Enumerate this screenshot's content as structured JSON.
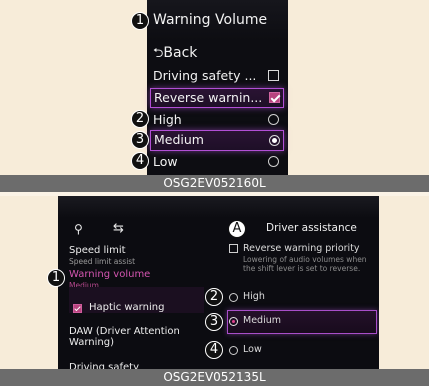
{
  "panel1": {
    "title": "Warning Volume",
    "back_label": "Back",
    "back_icon": "back-arrow-icon",
    "items": [
      {
        "label": "Driving safety ...",
        "checked": false
      },
      {
        "label": "Reverse warnin...",
        "checked": true
      }
    ],
    "options": [
      {
        "label": "High",
        "selected": false
      },
      {
        "label": "Medium",
        "selected": true
      },
      {
        "label": "Low",
        "selected": false
      }
    ],
    "callouts": [
      "1",
      "2",
      "3",
      "4"
    ],
    "caption": "OSG2EV052160L"
  },
  "panel2": {
    "toolbar_icons": [
      "search-icon",
      "swap-icon"
    ],
    "left_items": [
      {
        "title": "Speed limit",
        "subtitle": "Speed limit assist"
      },
      {
        "title": "Warning volume",
        "subtitle": "Medium"
      },
      {
        "title": "Haptic warning",
        "checked": true
      },
      {
        "title": "DAW (Driver Attention Warning)"
      },
      {
        "title": "Driving safety"
      }
    ],
    "right_title": "Driver assistance",
    "right_checkbox": {
      "label": "Reverse warning priority",
      "checked": false
    },
    "right_description": "Lowering of audio volumes when the shift lever is set to reverse.",
    "options": [
      {
        "label": "High",
        "selected": false
      },
      {
        "label": "Medium",
        "selected": true
      },
      {
        "label": "Low",
        "selected": false
      }
    ],
    "callouts": [
      "A",
      "1",
      "2",
      "3",
      "4"
    ],
    "caption": "OSG2EV052135L"
  },
  "colors": {
    "accent_pink": "#d455b0",
    "selection_border": "#b24fd6",
    "screen_bg": "#0d0d12",
    "caption_bg": "#6c6c6c",
    "page_bg": "#f7ecd9"
  }
}
